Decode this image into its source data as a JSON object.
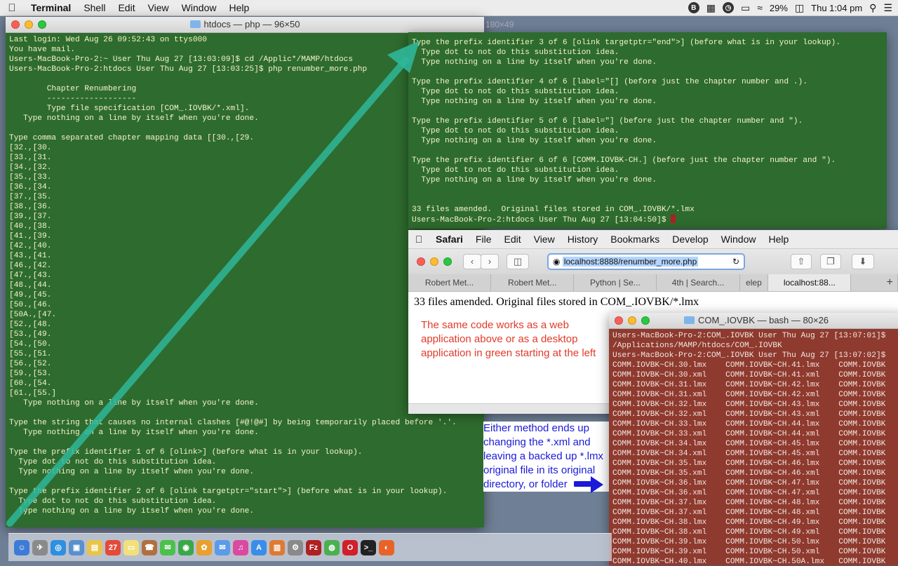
{
  "menubar": {
    "app_name": "Terminal",
    "items": [
      "Shell",
      "Edit",
      "View",
      "Window",
      "Help"
    ],
    "battery": "29%",
    "clock": "Thu 1:04 pm"
  },
  "main_window": {
    "title": "htdocs — php — 96×50",
    "ghost_size": "180×49",
    "lines": [
      "Last login: Wed Aug 26 09:52:43 on ttys000",
      "You have mail.",
      "Users-MacBook-Pro-2:~ User Thu Aug 27 [13:03:09]$ cd /Applic*/MAMP/htdocs",
      "Users-MacBook-Pro-2:htdocs User Thu Aug 27 [13:03:25]$ php renumber_more.php",
      "",
      "        Chapter Renumbering",
      "        -------------------",
      "        Type file specification [COM_.IOVBK/*.xml].",
      "   Type nothing on a line by itself when you're done.",
      "",
      "Type comma separated chapter mapping data [[30.,[29.",
      "[32.,[30.",
      "[33.,[31.",
      "[34.,[32.",
      "[35.,[33.",
      "[36.,[34.",
      "[37.,[35.",
      "[38.,[36.",
      "[39.,[37.",
      "[40.,[38.",
      "[41.,[39.",
      "[42.,[40.",
      "[43.,[41.",
      "[46.,[42.",
      "[47.,[43.",
      "[48.,[44.",
      "[49.,[45.",
      "[50.,[46.",
      "[50A.,[47.",
      "[52.,[48.",
      "[53.,[49.",
      "[54.,[50.",
      "[55.,[51.",
      "[56.,[52.",
      "[59.,[53.",
      "[60.,[54.",
      "[61.,[55.]",
      "   Type nothing on a line by itself when you're done.",
      "",
      "Type the string that causes no internal clashes [#@!@#] by being temporarily placed before '.'.",
      "   Type nothing on a line by itself when you're done.",
      "",
      "Type the prefix identifier 1 of 6 [olink>] (before what is in your lookup).",
      "  Type dot to not do this substitution idea.",
      "  Type nothing on a line by itself when you're done.",
      "",
      "Type the prefix identifier 2 of 6 [olink targetptr=\"start\">] (before what is in your lookup).",
      "  Type dot to not do this substitution idea.",
      "  Type nothing on a line by itself when you're done."
    ]
  },
  "overlay_window": {
    "lines": [
      "Type the prefix identifier 3 of 6 [olink targetptr=\"end\">] (before what is in your lookup).",
      "  Type dot to not do this substitution idea.",
      "  Type nothing on a line by itself when you're done.",
      "",
      "Type the prefix identifier 4 of 6 [label=\"[] (before just the chapter number and .).",
      "  Type dot to not do this substitution idea.",
      "  Type nothing on a line by itself when you're done.",
      "",
      "Type the prefix identifier 5 of 6 [label=\"] (before just the chapter number and \").",
      "  Type dot to not do this substitution idea.",
      "  Type nothing on a line by itself when you're done.",
      "",
      "Type the prefix identifier 6 of 6 [COMM.IOVBK-CH.] (before just the chapter number and \").",
      "  Type dot to not do this substitution idea.",
      "  Type nothing on a line by itself when you're done.",
      "",
      "",
      "33 files amended.  Original files stored in COM_.IOVBK/*.lmx"
    ],
    "prompt": "Users-MacBook-Pro-2:htdocs User Thu Aug 27 [13:04:50]$ "
  },
  "safari": {
    "app_name": "Safari",
    "menu_items": [
      "File",
      "Edit",
      "View",
      "History",
      "Bookmarks",
      "Develop",
      "Window",
      "Help"
    ],
    "url": "localhost:8888/renumber_more.php",
    "tabs": [
      "Robert Met...",
      "Robert Met...",
      "Python | Se...",
      "4th | Search...",
      "elep",
      "localhost:88..."
    ],
    "page_text": "33 files amended. Original files stored in COM_.IOVBK/*.lmx",
    "red_note": "The same code works as a web application above or as a desktop application in green starting at the left"
  },
  "blue_note": "Either method ends up changing the *.xml and leaving a backed up *.lmx original file in its original directory, or folder",
  "bash_window": {
    "title": "COM_.IOVBK — bash — 80×26",
    "lines": [
      "Users-MacBook-Pro-2:COM_.IOVBK User Thu Aug 27 [13:07:01]$",
      "/Applications/MAMP/htdocs/COM_.IOVBK",
      "Users-MacBook-Pro-2:COM_.IOVBK User Thu Aug 27 [13:07:02]$",
      "COMM.IOVBK~CH.30.lmx    COMM.IOVBK~CH.41.lmx    COMM.IOVBK",
      "COMM.IOVBK~CH.30.xml    COMM.IOVBK~CH.41.xml    COMM.IOVBK",
      "COMM.IOVBK~CH.31.lmx    COMM.IOVBK~CH.42.lmx    COMM.IOVBK",
      "COMM.IOVBK~CH.31.xml    COMM.IOVBK~CH.42.xml    COMM.IOVBK",
      "COMM.IOVBK~CH.32.lmx    COMM.IOVBK~CH.43.lmx    COMM.IOVBK",
      "COMM.IOVBK~CH.32.xml    COMM.IOVBK~CH.43.xml    COMM.IOVBK",
      "COMM.IOVBK~CH.33.lmx    COMM.IOVBK~CH.44.lmx    COMM.IOVBK",
      "COMM.IOVBK~CH.33.xml    COMM.IOVBK~CH.44.xml    COMM.IOVBK",
      "COMM.IOVBK~CH.34.lmx    COMM.IOVBK~CH.45.lmx    COMM.IOVBK",
      "COMM.IOVBK~CH.34.xml    COMM.IOVBK~CH.45.xml    COMM.IOVBK",
      "COMM.IOVBK~CH.35.lmx    COMM.IOVBK~CH.46.lmx    COMM.IOVBK",
      "COMM.IOVBK~CH.35.xml    COMM.IOVBK~CH.46.xml    COMM.IOVBK",
      "COMM.IOVBK~CH.36.lmx    COMM.IOVBK~CH.47.lmx    COMM.IOVBK",
      "COMM.IOVBK~CH.36.xml    COMM.IOVBK~CH.47.xml    COMM.IOVBK",
      "COMM.IOVBK~CH.37.lmx    COMM.IOVBK~CH.48.lmx    COMM.IOVBK",
      "COMM.IOVBK~CH.37.xml    COMM.IOVBK~CH.48.xml    COMM.IOVBK",
      "COMM.IOVBK~CH.38.lmx    COMM.IOVBK~CH.49.lmx    COMM.IOVBK",
      "COMM.IOVBK~CH.38.xml    COMM.IOVBK~CH.49.xml    COMM.IOVBK",
      "COMM.IOVBK~CH.39.lmx    COMM.IOVBK~CH.50.lmx    COMM.IOVBK",
      "COMM.IOVBK~CH.39.xml    COMM.IOVBK~CH.50.xml    COMM.IOVBK",
      "COMM.IOVBK~CH.40.lmx    COMM.IOVBK~CH.50A.lmx   COMM.IOVBK"
    ]
  },
  "colors": {
    "terminal_green": "#2e6b2e",
    "terminal_red": "#8f3a2f",
    "arrow_teal": "#2fb79a",
    "note_red": "#e23a2a",
    "note_blue": "#1a1ad8"
  },
  "dock_icons": [
    "finder-icon",
    "launchpad-icon",
    "safari-icon",
    "preview-icon",
    "notes-icon",
    "calendar-icon",
    "stickies-icon",
    "contacts-icon",
    "messages-icon",
    "facetime-icon",
    "photos-icon",
    "mail-icon",
    "itunes-icon",
    "app-store-icon",
    "books-icon",
    "system-prefs-icon",
    "filezilla-icon",
    "chrome-icon",
    "opera-icon",
    "terminal-icon",
    "firefox-icon"
  ]
}
